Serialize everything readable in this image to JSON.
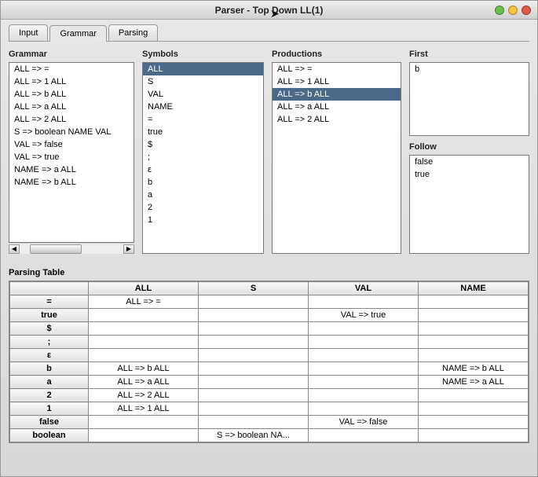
{
  "window": {
    "title": "Parser - Top Down LL(1)"
  },
  "tabs": [
    {
      "label": "Input",
      "active": false
    },
    {
      "label": "Grammar",
      "active": true
    },
    {
      "label": "Parsing",
      "active": false
    }
  ],
  "sections": {
    "grammar": {
      "label": "Grammar"
    },
    "symbols": {
      "label": "Symbols"
    },
    "productions": {
      "label": "Productions"
    },
    "first": {
      "label": "First"
    },
    "follow": {
      "label": "Follow"
    },
    "parsing_table": {
      "label": "Parsing Table"
    }
  },
  "grammar_items": [
    "ALL => =",
    "ALL => 1 ALL",
    "ALL => b ALL",
    "ALL => a ALL",
    "ALL => 2 ALL",
    "S => boolean NAME VAL",
    "VAL => false",
    "VAL => true",
    "NAME => a ALL",
    "NAME => b ALL"
  ],
  "symbols_items": [
    "ALL",
    "S",
    "VAL",
    "NAME",
    "=",
    "true",
    "$",
    ";",
    "ε",
    "b",
    "a",
    "2",
    "1"
  ],
  "symbols_selected_index": 0,
  "productions_items": [
    "ALL => =",
    "ALL => 1 ALL",
    "ALL => b ALL",
    "ALL => a ALL",
    "ALL => 2 ALL"
  ],
  "productions_selected_index": 2,
  "first_items": [
    "b"
  ],
  "follow_items": [
    "false",
    "true"
  ],
  "parsing_table": {
    "columns": [
      "ALL",
      "S",
      "VAL",
      "NAME"
    ],
    "rows": [
      {
        "head": "=",
        "cells": [
          "ALL => =",
          "",
          "",
          ""
        ]
      },
      {
        "head": "true",
        "cells": [
          "",
          "",
          "VAL => true",
          ""
        ]
      },
      {
        "head": "$",
        "cells": [
          "",
          "",
          "",
          ""
        ]
      },
      {
        "head": ";",
        "cells": [
          "",
          "",
          "",
          ""
        ]
      },
      {
        "head": "ε",
        "cells": [
          "",
          "",
          "",
          ""
        ]
      },
      {
        "head": "b",
        "cells": [
          "ALL => b ALL",
          "",
          "",
          "NAME => b ALL"
        ]
      },
      {
        "head": "a",
        "cells": [
          "ALL => a ALL",
          "",
          "",
          "NAME => a ALL"
        ]
      },
      {
        "head": "2",
        "cells": [
          "ALL => 2 ALL",
          "",
          "",
          ""
        ]
      },
      {
        "head": "1",
        "cells": [
          "ALL => 1 ALL",
          "",
          "",
          ""
        ]
      },
      {
        "head": "false",
        "cells": [
          "",
          "",
          "VAL => false",
          ""
        ]
      },
      {
        "head": "boolean",
        "cells": [
          "",
          "S => boolean NA...",
          "",
          ""
        ]
      }
    ]
  }
}
